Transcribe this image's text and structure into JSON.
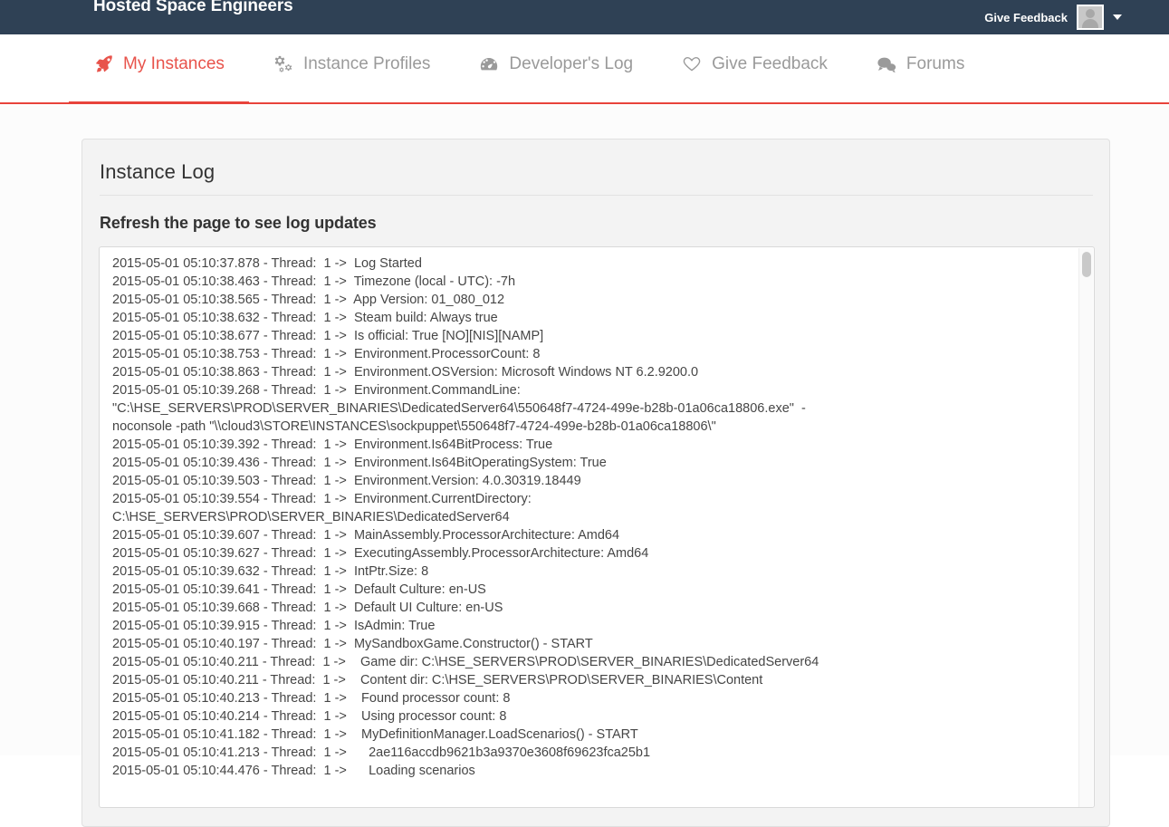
{
  "topbar": {
    "brand": "Hosted Space Engineers",
    "give_feedback_label": "Give Feedback",
    "avatar_icon": "user-avatar-icon",
    "caret_icon": "chevron-down-icon",
    "bg_color": "#2f4155"
  },
  "nav": {
    "accent_color": "#e8433b",
    "inactive_color": "#9a9a9a",
    "items": [
      {
        "label": "My Instances",
        "icon": "rocket-icon",
        "active": true
      },
      {
        "label": "Instance Profiles",
        "icon": "gears-icon",
        "active": false
      },
      {
        "label": "Developer's Log",
        "icon": "dashboard-icon",
        "active": false
      },
      {
        "label": "Give Feedback",
        "icon": "heart-icon",
        "active": false
      },
      {
        "label": "Forums",
        "icon": "comments-icon",
        "active": false
      }
    ]
  },
  "panel": {
    "title": "Instance Log",
    "subtitle": "Refresh the page to see log updates"
  },
  "log": {
    "lines": [
      "2015-05-01 05:10:37.878 - Thread:  1 ->  Log Started",
      "2015-05-01 05:10:38.463 - Thread:  1 ->  Timezone (local - UTC): -7h",
      "2015-05-01 05:10:38.565 - Thread:  1 ->  App Version: 01_080_012",
      "2015-05-01 05:10:38.632 - Thread:  1 ->  Steam build: Always true",
      "2015-05-01 05:10:38.677 - Thread:  1 ->  Is official: True [NO][NIS][NAMP]",
      "2015-05-01 05:10:38.753 - Thread:  1 ->  Environment.ProcessorCount: 8",
      "2015-05-01 05:10:38.863 - Thread:  1 ->  Environment.OSVersion: Microsoft Windows NT 6.2.9200.0",
      "2015-05-01 05:10:39.268 - Thread:  1 ->  Environment.CommandLine: \"C:\\HSE_SERVERS\\PROD\\SERVER_BINARIES\\DedicatedServer64\\550648f7-4724-499e-b28b-01a06ca18806.exe\"  -noconsole -path \"\\\\cloud3\\STORE\\INSTANCES\\sockpuppet\\550648f7-4724-499e-b28b-01a06ca18806\\\"",
      "2015-05-01 05:10:39.392 - Thread:  1 ->  Environment.Is64BitProcess: True",
      "2015-05-01 05:10:39.436 - Thread:  1 ->  Environment.Is64BitOperatingSystem: True",
      "2015-05-01 05:10:39.503 - Thread:  1 ->  Environment.Version: 4.0.30319.18449",
      "2015-05-01 05:10:39.554 - Thread:  1 ->  Environment.CurrentDirectory: C:\\HSE_SERVERS\\PROD\\SERVER_BINARIES\\DedicatedServer64",
      "2015-05-01 05:10:39.607 - Thread:  1 ->  MainAssembly.ProcessorArchitecture: Amd64",
      "2015-05-01 05:10:39.627 - Thread:  1 ->  ExecutingAssembly.ProcessorArchitecture: Amd64",
      "2015-05-01 05:10:39.632 - Thread:  1 ->  IntPtr.Size: 8",
      "2015-05-01 05:10:39.641 - Thread:  1 ->  Default Culture: en-US",
      "2015-05-01 05:10:39.668 - Thread:  1 ->  Default UI Culture: en-US",
      "2015-05-01 05:10:39.915 - Thread:  1 ->  IsAdmin: True",
      "2015-05-01 05:10:40.197 - Thread:  1 ->  MySandboxGame.Constructor() - START",
      "2015-05-01 05:10:40.211 - Thread:  1 ->    Game dir: C:\\HSE_SERVERS\\PROD\\SERVER_BINARIES\\DedicatedServer64",
      "2015-05-01 05:10:40.211 - Thread:  1 ->    Content dir: C:\\HSE_SERVERS\\PROD\\SERVER_BINARIES\\Content",
      "2015-05-01 05:10:40.213 - Thread:  1 ->    Found processor count: 8",
      "2015-05-01 05:10:40.214 - Thread:  1 ->    Using processor count: 8",
      "2015-05-01 05:10:41.182 - Thread:  1 ->    MyDefinitionManager.LoadScenarios() - START",
      "2015-05-01 05:10:41.213 - Thread:  1 ->      2ae116accdb9621b3a9370e3608f69623fca25b1",
      "2015-05-01 05:10:44.476 - Thread:  1 ->      Loading scenarios"
    ]
  }
}
